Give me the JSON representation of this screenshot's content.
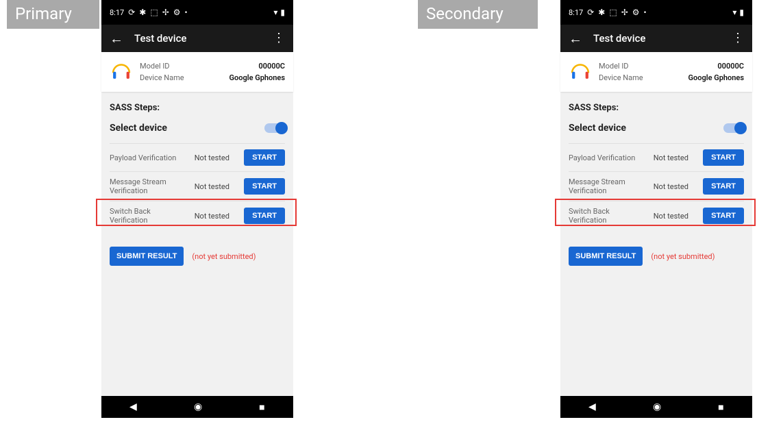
{
  "labels": {
    "primary": "Primary",
    "secondary": "Secondary"
  },
  "statusbar": {
    "time": "8:17"
  },
  "appbar": {
    "title": "Test device"
  },
  "device": {
    "model_label": "Model ID",
    "model_value": "00000C",
    "name_label": "Device Name",
    "name_value": "Google Gphones"
  },
  "section": {
    "title": "SASS Steps:",
    "select_label": "Select device"
  },
  "tests": [
    {
      "name": "Payload Verification",
      "status": "Not tested",
      "button": "START"
    },
    {
      "name": "Message Stream Verification",
      "status": "Not tested",
      "button": "START"
    },
    {
      "name": "Switch Back Verification",
      "status": "Not tested",
      "button": "START"
    }
  ],
  "submit": {
    "button": "SUBMIT RESULT",
    "status": "(not yet submitted)"
  }
}
